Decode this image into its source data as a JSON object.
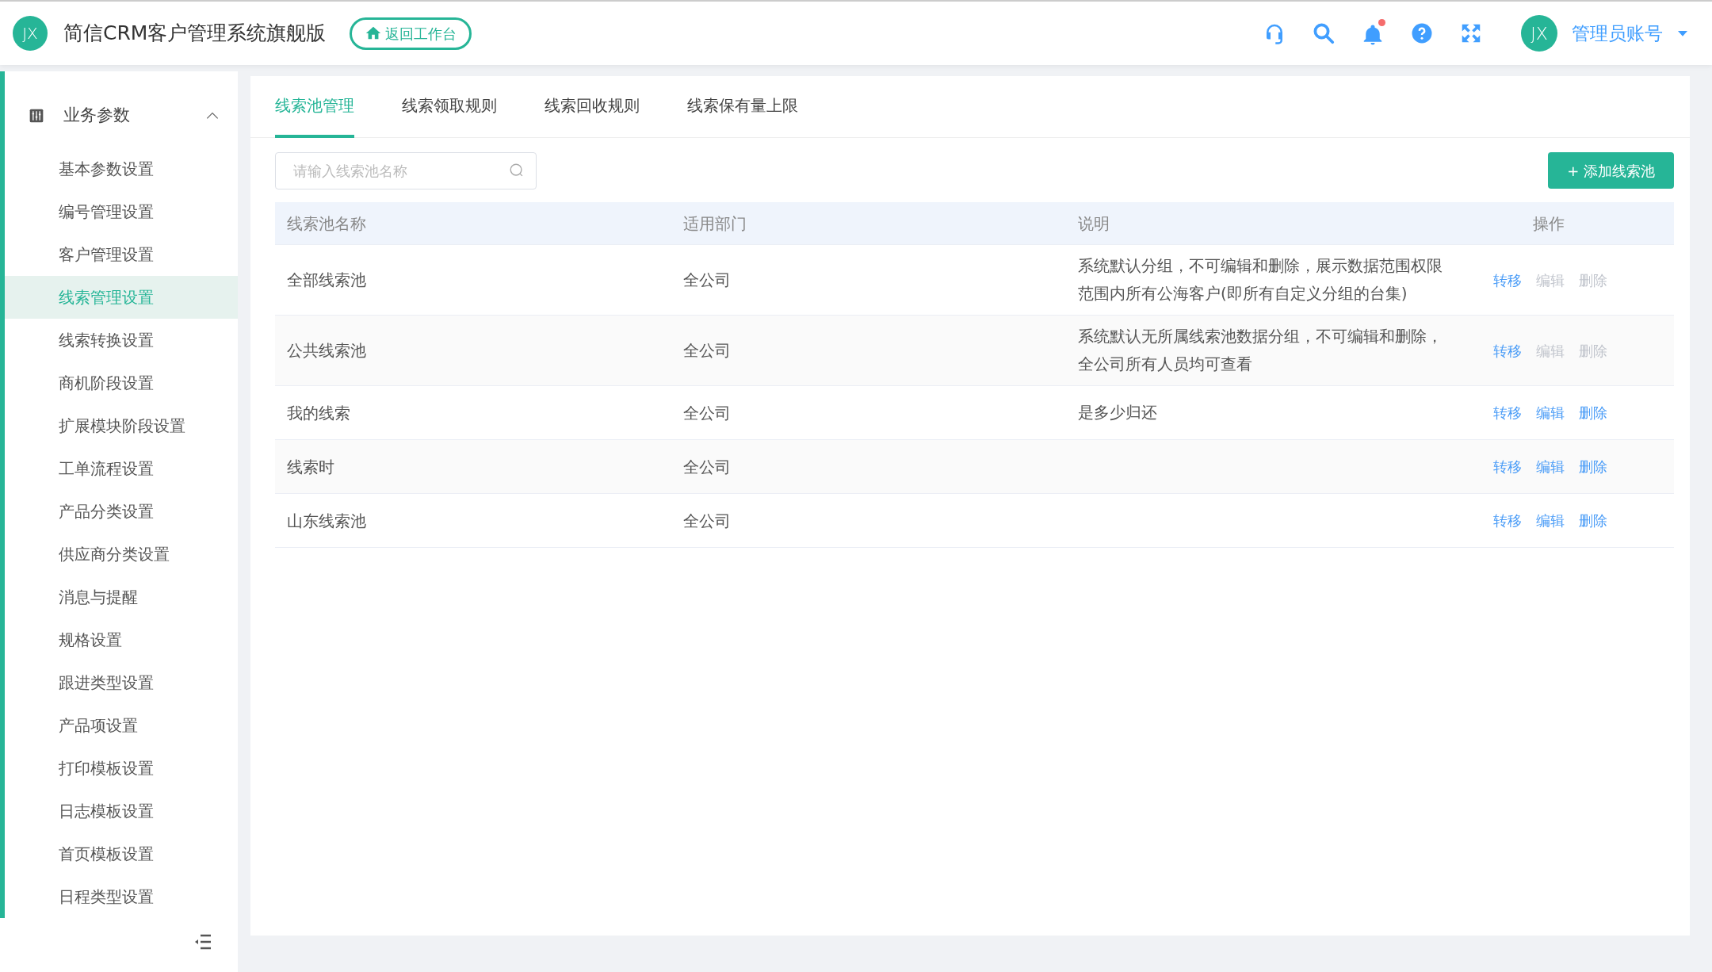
{
  "header": {
    "logo_text": "JX",
    "app_title": "简信CRM客户管理系统旗舰版",
    "back_button": "返回工作台",
    "notification_dot": true,
    "user": {
      "avatar_text": "JX",
      "name": "管理员账号"
    }
  },
  "sidebar": {
    "group": {
      "label": "业务参数",
      "expanded": true,
      "children": [
        {
          "label": "基本参数设置",
          "selected": false
        },
        {
          "label": "编号管理设置",
          "selected": false
        },
        {
          "label": "客户管理设置",
          "selected": false
        },
        {
          "label": "线索管理设置",
          "selected": true
        },
        {
          "label": "线索转换设置",
          "selected": false
        },
        {
          "label": "商机阶段设置",
          "selected": false
        },
        {
          "label": "扩展模块阶段设置",
          "selected": false
        },
        {
          "label": "工单流程设置",
          "selected": false
        },
        {
          "label": "产品分类设置",
          "selected": false
        },
        {
          "label": "供应商分类设置",
          "selected": false
        },
        {
          "label": "消息与提醒",
          "selected": false
        },
        {
          "label": "规格设置",
          "selected": false
        },
        {
          "label": "跟进类型设置",
          "selected": false
        },
        {
          "label": "产品项设置",
          "selected": false
        },
        {
          "label": "打印模板设置",
          "selected": false
        },
        {
          "label": "日志模板设置",
          "selected": false
        },
        {
          "label": "首页模板设置",
          "selected": false
        },
        {
          "label": "日程类型设置",
          "selected": false
        }
      ]
    }
  },
  "tabs": [
    {
      "label": "线索池管理",
      "selected": true
    },
    {
      "label": "线索领取规则",
      "selected": false
    },
    {
      "label": "线索回收规则",
      "selected": false
    },
    {
      "label": "线索保有量上限",
      "selected": false
    }
  ],
  "search": {
    "placeholder": "请输入线索池名称"
  },
  "add_button": "+ 添加线索池",
  "table": {
    "columns": [
      "线索池名称",
      "适用部门",
      "说明",
      "操作"
    ],
    "rows": [
      {
        "name": "全部线索池",
        "department": "全公司",
        "description": "系统默认分组，不可编辑和删除，展示数据范围权限范围内所有公海客户(即所有自定义分组的台集)",
        "actions": [
          {
            "label": "转移",
            "disabled": false
          },
          {
            "label": "编辑",
            "disabled": true
          },
          {
            "label": "删除",
            "disabled": true
          }
        ]
      },
      {
        "name": "公共线索池",
        "department": "全公司",
        "description": "系统默认无所属线索池数据分组，不可编辑和删除，全公司所有人员均可查看",
        "actions": [
          {
            "label": "转移",
            "disabled": false
          },
          {
            "label": "编辑",
            "disabled": true
          },
          {
            "label": "删除",
            "disabled": true
          }
        ]
      },
      {
        "name": "我的线索",
        "department": "全公司",
        "description": "是多少归还",
        "actions": [
          {
            "label": "转移",
            "disabled": false
          },
          {
            "label": "编辑",
            "disabled": false
          },
          {
            "label": "删除",
            "disabled": false
          }
        ]
      },
      {
        "name": "线索时",
        "department": "全公司",
        "actions": [
          {
            "label": "转移",
            "disabled": false
          },
          {
            "label": "编辑",
            "disabled": false
          },
          {
            "label": "删除",
            "disabled": false
          }
        ]
      },
      {
        "name": "山东线索池",
        "department": "全公司",
        "actions": [
          {
            "label": "转移",
            "disabled": false
          },
          {
            "label": "编辑",
            "disabled": false
          },
          {
            "label": "删除",
            "disabled": false
          }
        ]
      }
    ]
  }
}
